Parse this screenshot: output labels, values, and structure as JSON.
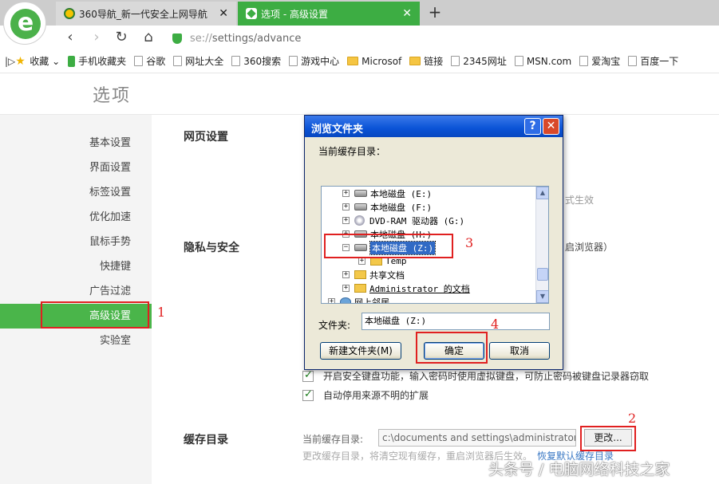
{
  "browser": {
    "tabs": [
      {
        "title": "360导航_新一代安全上网导航",
        "close": "✕"
      },
      {
        "title": "选项 - 高级设置",
        "close": "✕"
      }
    ],
    "new_tab": "+",
    "nav": {
      "back": "‹",
      "forward": "›",
      "reload": "↻",
      "home": "⌂"
    },
    "url_host": "se://",
    "url_path": "settings/advance",
    "accent_color": "#3dad43"
  },
  "bookmarks": {
    "toggle": "|▷",
    "items": [
      {
        "label": "收藏",
        "icon": "star-icon"
      },
      {
        "label": "手机收藏夹",
        "icon": "phone-icon"
      },
      {
        "label": "谷歌",
        "icon": "page-icon"
      },
      {
        "label": "网址大全",
        "icon": "page-icon"
      },
      {
        "label": "360搜索",
        "icon": "page-icon"
      },
      {
        "label": "游戏中心",
        "icon": "page-icon"
      },
      {
        "label": "Microsof",
        "icon": "folder-icon"
      },
      {
        "label": "链接",
        "icon": "folder-icon"
      },
      {
        "label": "2345网址",
        "icon": "page-icon"
      },
      {
        "label": "MSN.com",
        "icon": "page-icon"
      },
      {
        "label": "爱淘宝",
        "icon": "page-icon"
      },
      {
        "label": "百度一下",
        "icon": "page-icon"
      }
    ]
  },
  "page": {
    "title": "选项",
    "sidebar": [
      "基本设置",
      "界面设置",
      "标签设置",
      "优化加速",
      "鼠标手势",
      "快捷键",
      "广告过滤",
      "高级设置",
      "实验室"
    ],
    "active_index": 7,
    "sections": {
      "web": "网页设置",
      "privacy": "隐私与安全",
      "cache": "缓存目录"
    },
    "bg_fragments": {
      "effect": "式生效",
      "restart": "启浏览器）"
    },
    "checkboxes": [
      {
        "label": "开启安全键盘功能，输入密码时使用虚拟键盘，可防止密码被键盘记录器窃取",
        "checked": true
      },
      {
        "label": "自动停用来源不明的扩展",
        "checked": true
      }
    ],
    "cache_label": "当前缓存目录:",
    "cache_path": "c:\\documents and settings\\administrator\\a",
    "change_button": "更改...",
    "cache_note": "更改缓存目录，将清空现有缓存，重启浏览器后生效。",
    "restore_link": "恢复默认缓存目录"
  },
  "dialog": {
    "title": "浏览文件夹",
    "help": "?",
    "close": "✕",
    "current_label": "当前缓存目录：",
    "tree": [
      {
        "label": "本地磁盘 (E:)",
        "icon": "drive"
      },
      {
        "label": "本地磁盘 (F:)",
        "icon": "drive"
      },
      {
        "label": "DVD-RAM 驱动器 (G:)",
        "icon": "cd"
      },
      {
        "label": "本地磁盘 (H:)",
        "icon": "drive"
      },
      {
        "label": "本地磁盘 (Z:)",
        "icon": "drive"
      },
      {
        "label": "Temp",
        "icon": "folder"
      },
      {
        "label": "共享文档",
        "icon": "folder"
      },
      {
        "label": "Administrator 的文档",
        "icon": "folder"
      },
      {
        "label": "网上邻居",
        "icon": "network"
      }
    ],
    "folder_label": "文件夹:",
    "folder_value": "本地磁盘 (Z:)",
    "new_folder": "新建文件夹(M)",
    "ok": "确定",
    "cancel": "取消"
  },
  "annotations": [
    "1",
    "2",
    "3",
    "4"
  ],
  "watermark": "头条号 / 电脑网络科技之家"
}
